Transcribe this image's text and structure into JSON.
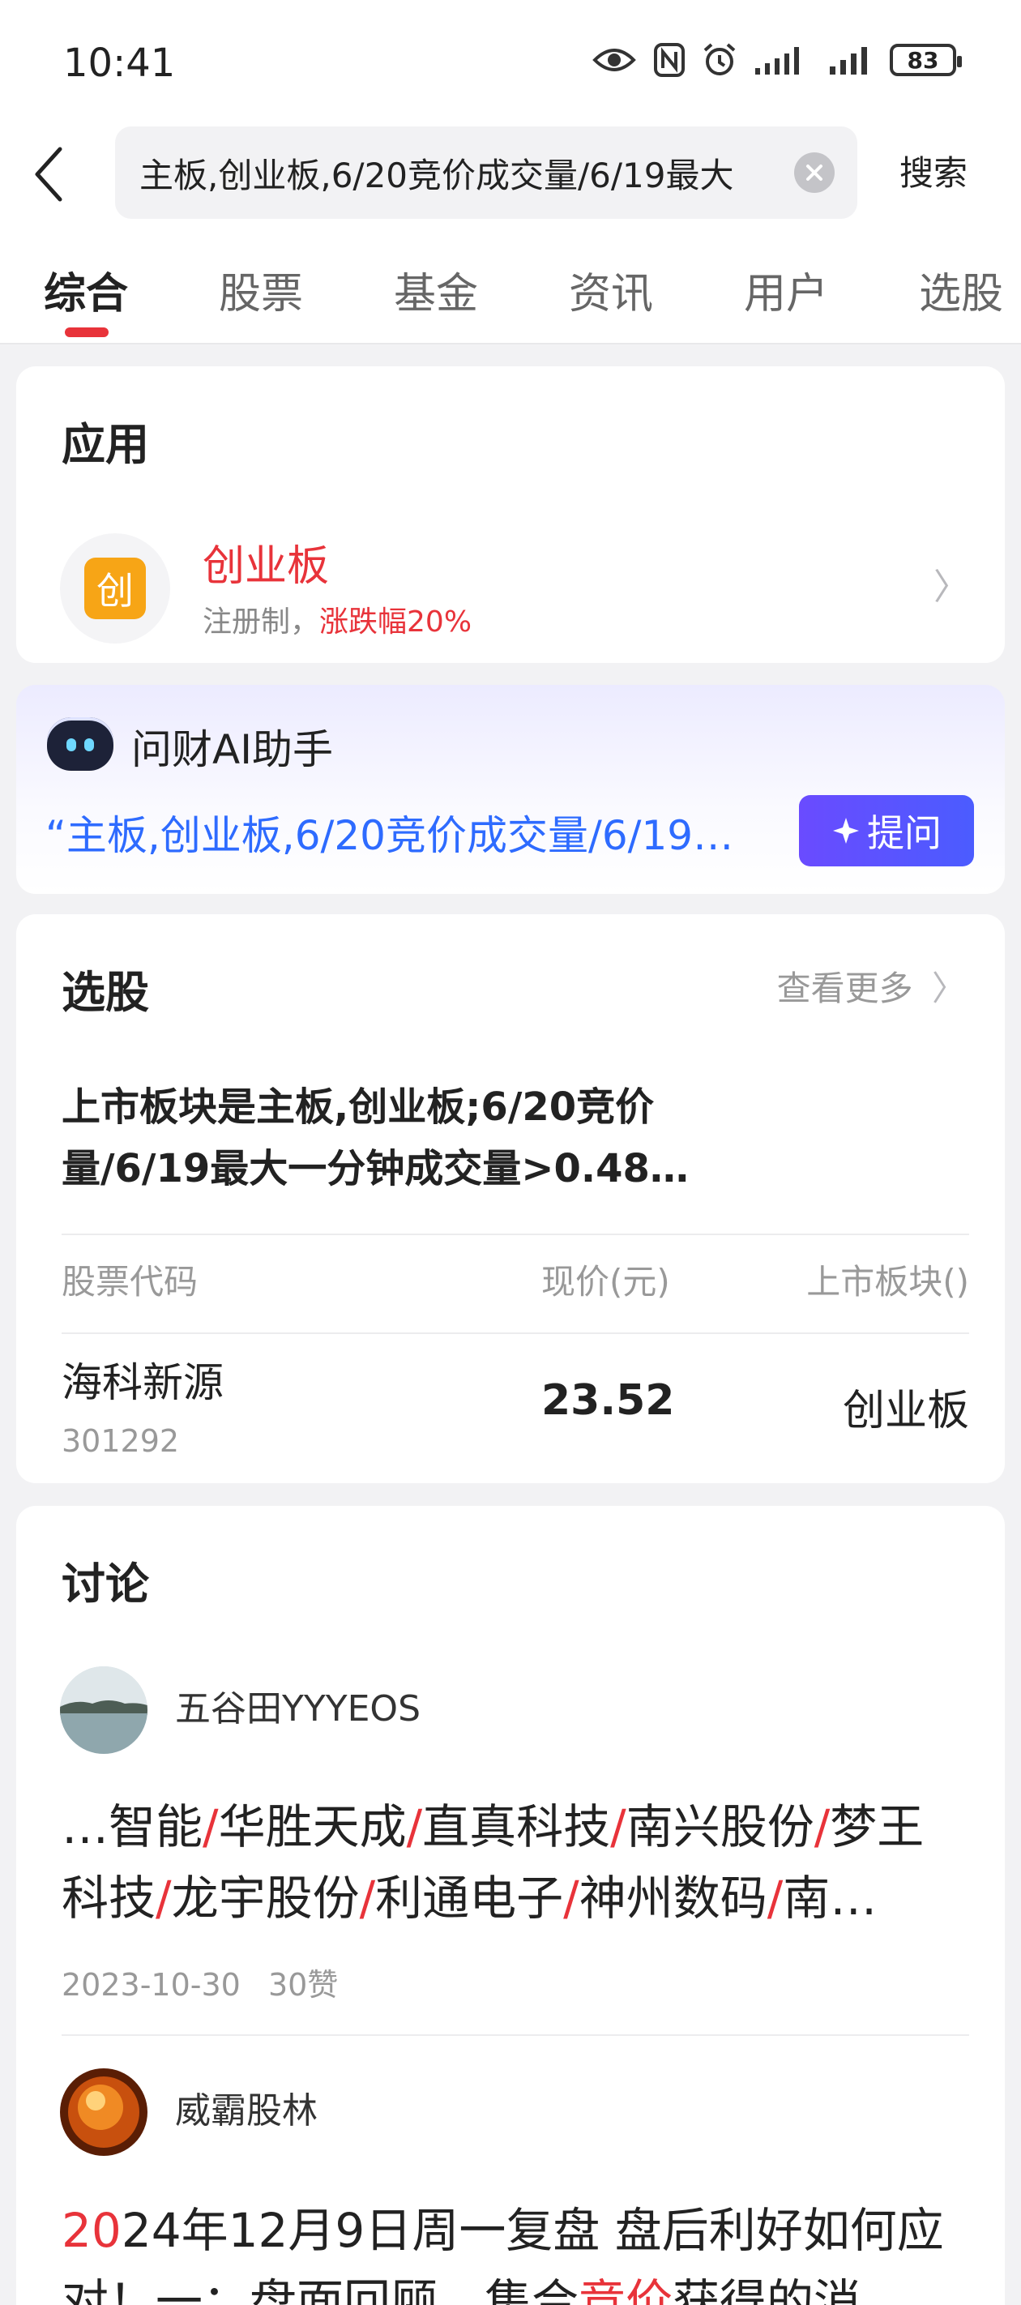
{
  "status_bar": {
    "time": "10:41",
    "battery": "83",
    "icons": [
      "eye-icon",
      "nfc-icon",
      "alarm-icon",
      "signal-icon",
      "signal-icon-2",
      "battery-icon"
    ]
  },
  "search": {
    "back_icon": "chevron-left-icon",
    "query": "主板,创业板,6/20竞价成交量/6/19最大",
    "clear_icon": "close-icon",
    "button_label": "搜索"
  },
  "tabs": [
    {
      "label": "综合",
      "active": true
    },
    {
      "label": "股票"
    },
    {
      "label": "基金"
    },
    {
      "label": "资讯"
    },
    {
      "label": "用户"
    },
    {
      "label": "选股"
    }
  ],
  "apps_section": {
    "title": "应用",
    "item": {
      "icon_char": "创",
      "name": "创业板",
      "desc_prefix": "注册制，",
      "desc_highlight": "涨跌幅20%",
      "chevron": "〉"
    }
  },
  "ai_assistant": {
    "title": "问财AI助手",
    "question": "“主板,创业板,6/20竞价成交量/6/19…",
    "ask_button": "提问",
    "ask_icon": "sparkle-icon"
  },
  "stock_picker": {
    "title": "选股",
    "more_label": "查看更多",
    "chevron": "〉",
    "query_line1": "上市板块是主板,创业板;6/20竞价",
    "query_line2": "量/6/19最大一分钟成交量>0.48…",
    "columns": [
      "股票代码",
      "现价(元)",
      "上市板块()"
    ],
    "rows": [
      {
        "name": "海科新源",
        "code": "301292",
        "price": "23.52",
        "board": "创业板"
      }
    ]
  },
  "discussion": {
    "title": "讨论",
    "posts": [
      {
        "user": "五谷田YYYEOS",
        "line1": [
          "…智能",
          "/",
          "华胜天成",
          "/",
          "直真科技",
          "/",
          "南兴股份",
          "/",
          "梦王"
        ],
        "line2": [
          "科技",
          "/",
          "龙宇股份",
          "/",
          "利通电子",
          "/",
          "神州数码",
          "/",
          "南…"
        ],
        "date": "2023-10-30",
        "likes": "30赞"
      },
      {
        "user": "威霸股林",
        "line1_red": "20",
        "line1_rest": "24年12月9日周一复盘 盘后利好如何应",
        "line2_a": "对！一：盘面回顾，集合",
        "line2_red": "竞价",
        "line2_b": "获得的消"
      }
    ]
  },
  "colors": {
    "accent": "#e8333a",
    "ai_blue": "#2e6bff",
    "ask_button": "#5b52ff",
    "app_icon": "#f7a516"
  }
}
